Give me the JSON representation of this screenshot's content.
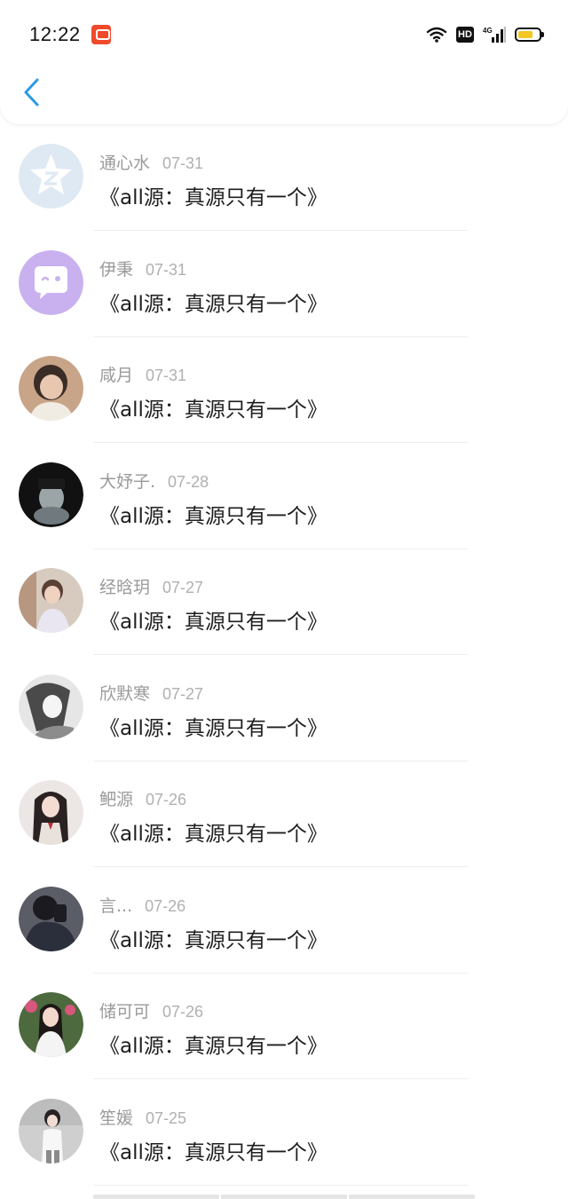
{
  "status_bar": {
    "time": "12:22",
    "hd_label": "HD",
    "network_label": "4G",
    "battery_color": "#f3c623"
  },
  "header": {
    "back_icon": "chevron-left-icon",
    "accent_color": "#2b9ae6"
  },
  "items": [
    {
      "name": "通心水",
      "date": "07-31",
      "content": "《all源：真源只有一个》",
      "avatar": "qq-star-default"
    },
    {
      "name": "伊秉",
      "date": "07-31",
      "content": "《all源：真源只有一个》",
      "avatar": "chat-bubble-default"
    },
    {
      "name": "咸月",
      "date": "07-31",
      "content": "《all源：真源只有一个》",
      "avatar": "photo"
    },
    {
      "name": "大妤子.",
      "date": "07-28",
      "content": "《all源：真源只有一个》",
      "avatar": "photo"
    },
    {
      "name": "经晗玥",
      "date": "07-27",
      "content": "《all源：真源只有一个》",
      "avatar": "photo"
    },
    {
      "name": "欣默寒",
      "date": "07-27",
      "content": "《all源：真源只有一个》",
      "avatar": "photo"
    },
    {
      "name": "鲃源",
      "date": "07-26",
      "content": "《all源：真源只有一个》",
      "avatar": "photo"
    },
    {
      "name": "言...",
      "date": "07-26",
      "content": "《all源：真源只有一个》",
      "avatar": "photo"
    },
    {
      "name": "储可可",
      "date": "07-26",
      "content": "《all源：真源只有一个》",
      "avatar": "photo"
    },
    {
      "name": "笙媛",
      "date": "07-25",
      "content": "《all源：真源只有一个》",
      "avatar": "photo"
    }
  ]
}
